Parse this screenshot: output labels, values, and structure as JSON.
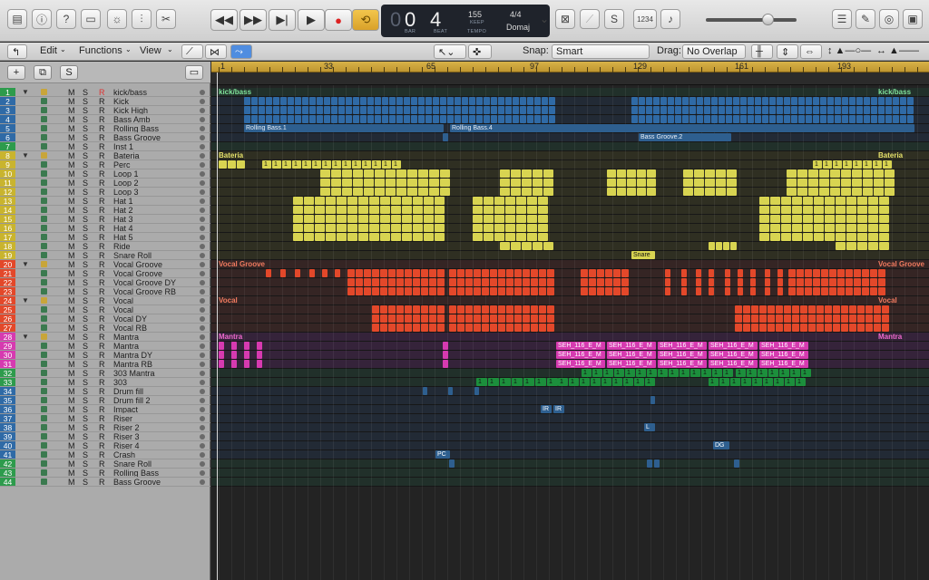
{
  "colors": {
    "green": "#2d9b4c",
    "blue": "#2f6aa6",
    "yellow": "#d8d451",
    "orange": "#e3482a",
    "magenta": "#d63ab0",
    "dkgreen": "#1c8f3c",
    "sblue": "#2e5f8f"
  },
  "toolbar": {
    "edit": "Edit",
    "functions": "Functions",
    "view": "View",
    "snap_label": "Snap:",
    "snap_value": "Smart",
    "drag_label": "Drag:",
    "drag_value": "No Overlap",
    "marker": "1234"
  },
  "lcd": {
    "bar": "0",
    "beat": "4",
    "bar_cap": "BAR",
    "beat_cap": "BEAT",
    "tempo": "155",
    "keep": "KEEP",
    "tempo_cap": "TEMPO",
    "sig": "4/4",
    "key": "Domaj"
  },
  "ruler": [
    "1",
    "33",
    "65",
    "97",
    "129",
    "161",
    "193"
  ],
  "tracks": [
    {
      "n": "1",
      "name": "kick/bass",
      "c": "#2d9b4c",
      "folder": true
    },
    {
      "n": "2",
      "name": "Kick",
      "c": "#2f6aa6"
    },
    {
      "n": "3",
      "name": "Kick High",
      "c": "#2f6aa6"
    },
    {
      "n": "4",
      "name": "Bass Amb",
      "c": "#2f6aa6"
    },
    {
      "n": "5",
      "name": "Rolling Bass",
      "c": "#2f6aa6"
    },
    {
      "n": "6",
      "name": "Bass Groove",
      "c": "#2f6aa6"
    },
    {
      "n": "7",
      "name": "Inst 1",
      "c": "#2d9b4c"
    },
    {
      "n": "8",
      "name": "Bateria",
      "c": "#c9b42e",
      "folder": true
    },
    {
      "n": "9",
      "name": "Perc",
      "c": "#c9b42e"
    },
    {
      "n": "10",
      "name": "Loop 1",
      "c": "#c9b42e"
    },
    {
      "n": "11",
      "name": "Loop 2",
      "c": "#c9b42e"
    },
    {
      "n": "12",
      "name": "Loop 3",
      "c": "#c9b42e"
    },
    {
      "n": "13",
      "name": "Hat 1",
      "c": "#c9b42e"
    },
    {
      "n": "14",
      "name": "Hat 2",
      "c": "#c9b42e"
    },
    {
      "n": "15",
      "name": "Hat 3",
      "c": "#c9b42e"
    },
    {
      "n": "16",
      "name": "Hat 4",
      "c": "#c9b42e"
    },
    {
      "n": "17",
      "name": "Hat 5",
      "c": "#c9b42e"
    },
    {
      "n": "18",
      "name": "Ride",
      "c": "#c9b42e"
    },
    {
      "n": "19",
      "name": "Snare Roll",
      "c": "#c9b42e"
    },
    {
      "n": "20",
      "name": "Vocal Groove",
      "c": "#e3482a",
      "folder": true
    },
    {
      "n": "21",
      "name": "Vocal Groove",
      "c": "#e3482a"
    },
    {
      "n": "22",
      "name": "Vocal Groove DY",
      "c": "#e3482a"
    },
    {
      "n": "23",
      "name": "Vocal Groove RB",
      "c": "#e3482a"
    },
    {
      "n": "24",
      "name": "Vocal",
      "c": "#e3482a",
      "folder": true
    },
    {
      "n": "25",
      "name": "Vocal",
      "c": "#e3482a"
    },
    {
      "n": "26",
      "name": "Vocal DY",
      "c": "#e3482a"
    },
    {
      "n": "27",
      "name": "Vocal RB",
      "c": "#e3482a"
    },
    {
      "n": "28",
      "name": "Mantra",
      "c": "#d63ab0",
      "folder": true
    },
    {
      "n": "29",
      "name": "Mantra",
      "c": "#d63ab0"
    },
    {
      "n": "30",
      "name": "Mantra DY",
      "c": "#d63ab0"
    },
    {
      "n": "31",
      "name": "Mantra RB",
      "c": "#d63ab0"
    },
    {
      "n": "32",
      "name": "303 Mantra",
      "c": "#2d9b4c"
    },
    {
      "n": "33",
      "name": "303",
      "c": "#2d9b4c"
    },
    {
      "n": "34",
      "name": "Drum fill",
      "c": "#2f6aa6"
    },
    {
      "n": "35",
      "name": "Drum fill 2",
      "c": "#2f6aa6"
    },
    {
      "n": "36",
      "name": "Impact",
      "c": "#2f6aa6"
    },
    {
      "n": "37",
      "name": "Riser",
      "c": "#2f6aa6"
    },
    {
      "n": "38",
      "name": "Riser 2",
      "c": "#2f6aa6"
    },
    {
      "n": "39",
      "name": "Riser 3",
      "c": "#2f6aa6"
    },
    {
      "n": "40",
      "name": "Riser 4",
      "c": "#2f6aa6"
    },
    {
      "n": "41",
      "name": "Crash",
      "c": "#2f6aa6"
    },
    {
      "n": "42",
      "name": "Snare Roll",
      "c": "#2d9b4c"
    },
    {
      "n": "43",
      "name": "Rolling Bass",
      "c": "#2d9b4c"
    },
    {
      "n": "44",
      "name": "Bass Groove",
      "c": "#2d9b4c"
    }
  ],
  "folder_labels": {
    "kick": "kick/bass",
    "bateria": "Bateria",
    "vgroove": "Vocal Groove",
    "vocal": "Vocal",
    "mantra": "Mantra"
  },
  "region_labels": {
    "rb1": "Rolling Bass.1",
    "rb4": "Rolling Bass.4",
    "bg2": "Bass Groove.2",
    "snare": "Snare",
    "seh": "SEH_116_E_M",
    "one": "1",
    "pc": "PC",
    "ir": "IR",
    "l": "L",
    "dg": "DG"
  }
}
